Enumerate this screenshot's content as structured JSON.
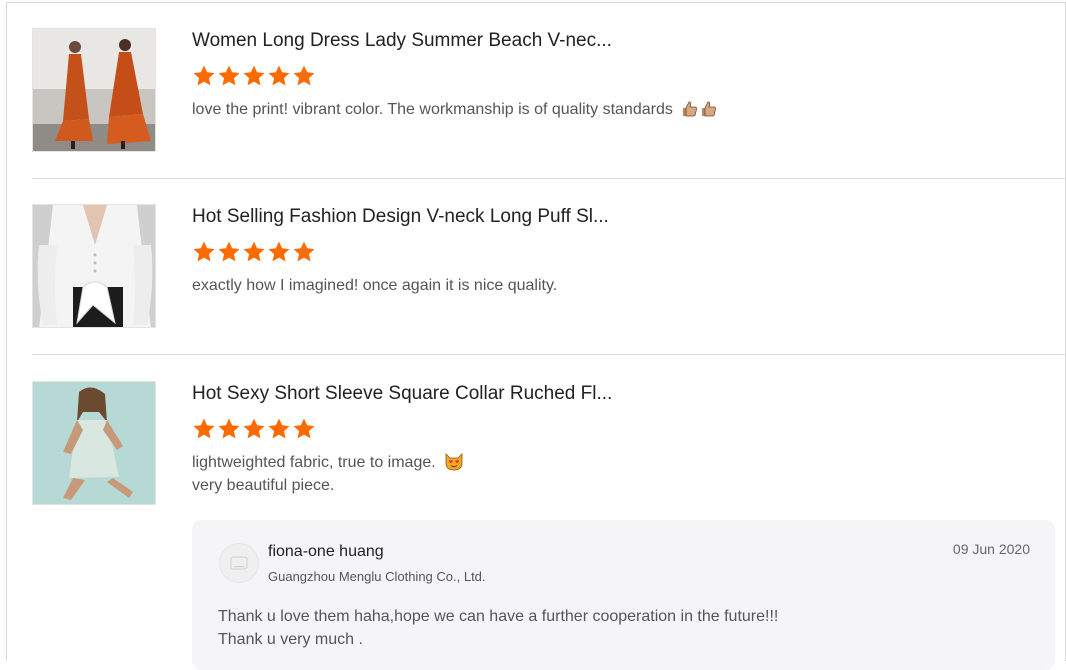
{
  "reviews": [
    {
      "title": "Women Long Dress Lady Summer Beach V-nec...",
      "rating": 5,
      "comment_lines": [
        "love the print!  vibrant color. The workmanship is of quality standards"
      ],
      "emoji": [
        "thumbs-up-icon",
        "thumbs-up-icon"
      ]
    },
    {
      "title": "Hot Selling Fashion Design V-neck Long Puff Sl...",
      "rating": 5,
      "comment_lines": [
        "exactly how I imagined! once again it is nice quality."
      ],
      "emoji": []
    },
    {
      "title": "Hot Sexy Short Sleeve Square Collar Ruched Fl...",
      "rating": 5,
      "comment_lines": [
        "lightweighted fabric, true to image.",
        "very beautiful piece."
      ],
      "emoji": [
        "heart-eyes-cat-icon"
      ]
    }
  ],
  "seller_reply": {
    "name": "fiona-one huang",
    "company": "Guangzhou Menglu Clothing Co., Ltd.",
    "date": "09 Jun 2020",
    "text_lines": [
      "Thank u love them haha,hope we can have a further cooperation in the future!!!",
      "Thank u very much ."
    ]
  },
  "colors": {
    "star": "#ff6a00",
    "reply_bg": "#f5f5f7"
  }
}
